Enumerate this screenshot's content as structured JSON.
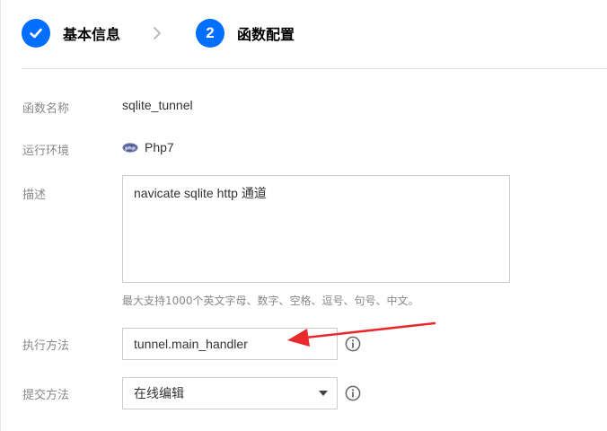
{
  "stepper": {
    "steps": [
      {
        "label": "基本信息",
        "state": "done"
      },
      {
        "number": "2",
        "label": "函数配置",
        "state": "active"
      }
    ]
  },
  "form": {
    "function_name": {
      "label": "函数名称",
      "value": "sqlite_tunnel"
    },
    "runtime": {
      "label": "运行环境",
      "value": "Php7",
      "icon": "php-icon"
    },
    "description": {
      "label": "描述",
      "value": "navicate sqlite http 通道",
      "help": "最大支持1000个英文字母、数字、空格、逗号、句号、中文。"
    },
    "handler": {
      "label": "执行方法",
      "value": "tunnel.main_handler"
    },
    "submit_method": {
      "label": "提交方法",
      "selected": "在线编辑"
    }
  },
  "colors": {
    "primary": "#006eff",
    "annotation": "#e8292d"
  }
}
